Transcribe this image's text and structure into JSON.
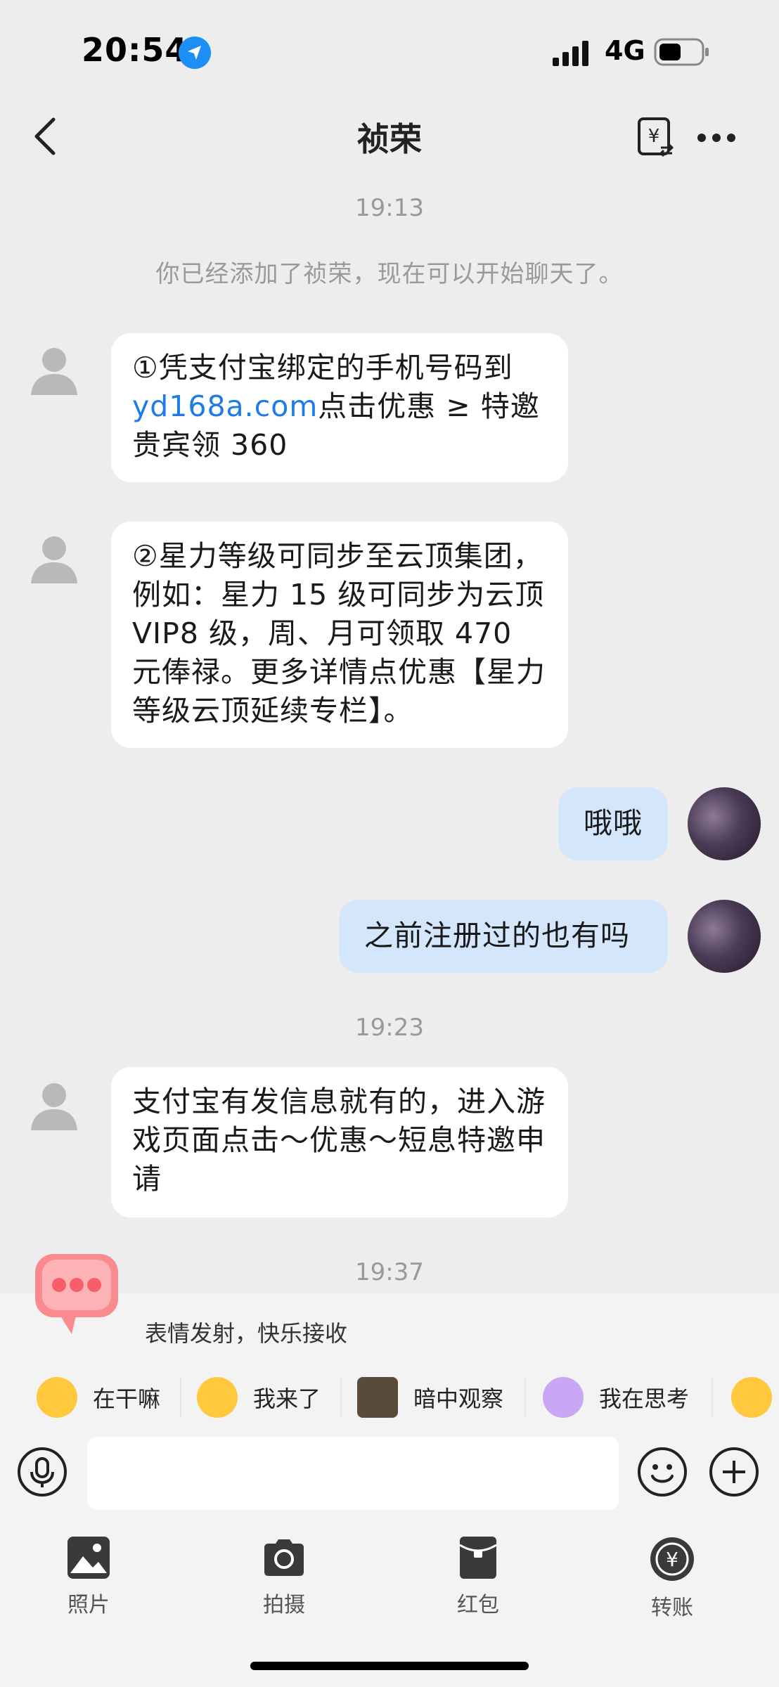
{
  "status_bar": {
    "time": "20:54",
    "network": "4G"
  },
  "nav": {
    "title": "祯荣"
  },
  "messages": {
    "ts1": "19:13",
    "system": "你已经添加了祯荣，现在可以开始聊天了。",
    "m1_a": "①凭支付宝绑定的手机号码到",
    "m1_link": "yd168a.com",
    "m1_b": "点击优惠 ≥ 特邀",
    "m1_c": "贵宾领 360",
    "m2": "②星力等级可同步至云顶集团，例如：星力 15 级可同步为云顶 VIP8 级，周、月可领取 470 元俸禄。更多详情点优惠【星力等级云顶延续专栏】。",
    "out1": "哦哦",
    "out2": "之前注册过的也有吗",
    "ts2": "19:23",
    "m3": "支付宝有发信息就有的，进入游戏页面点击～优惠～短息特邀申请",
    "ts3": "19:37"
  },
  "emoji_panel": {
    "tip": "表情发射，快乐接收",
    "chips": [
      "在干嘛",
      "我来了",
      "暗中观察",
      "我在思考"
    ]
  },
  "input": {
    "placeholder": ""
  },
  "toolbar": {
    "photo": "照片",
    "camera": "拍摄",
    "red_packet": "红包",
    "transfer": "转账"
  }
}
